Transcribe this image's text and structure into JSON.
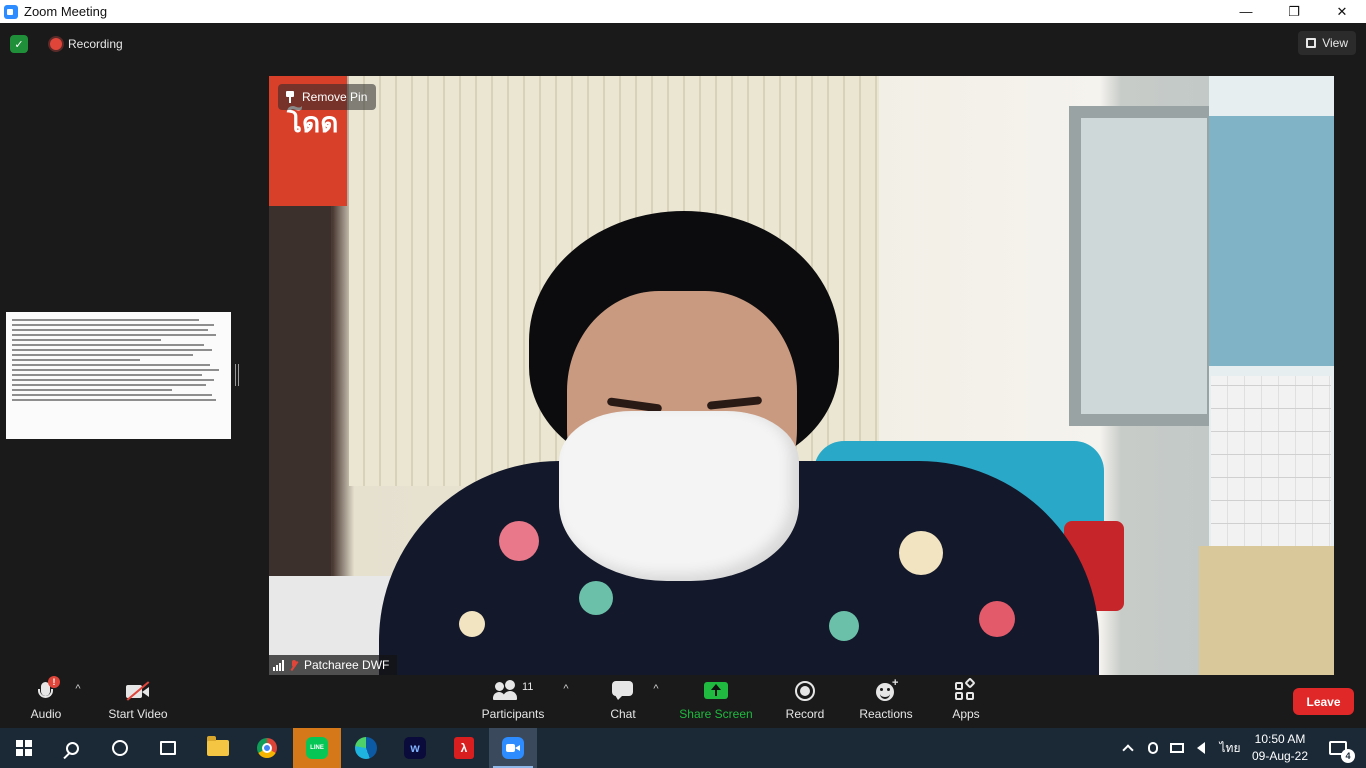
{
  "window": {
    "title": "Zoom Meeting",
    "controls": {
      "minimize": "—",
      "maximize": "❐",
      "close": "✕"
    }
  },
  "meeting": {
    "recording_label": "Recording",
    "view_label": "View",
    "remove_pin_label": "Remove Pin",
    "participant_name": "Patcharee DWF",
    "participant_muted": true,
    "signal_bars": 4
  },
  "toolbar": {
    "audio": {
      "label": "Audio",
      "alert": "!",
      "icon": "microphone-icon"
    },
    "video": {
      "label": "Start Video",
      "icon": "video-off-icon"
    },
    "participants": {
      "label": "Participants",
      "count": "11",
      "icon": "participants-icon"
    },
    "chat": {
      "label": "Chat",
      "icon": "chat-icon"
    },
    "share": {
      "label": "Share Screen",
      "icon": "share-screen-icon",
      "color": "#1fba3f"
    },
    "record": {
      "label": "Record",
      "icon": "record-icon"
    },
    "reactions": {
      "label": "Reactions",
      "icon": "reactions-icon"
    },
    "apps": {
      "label": "Apps",
      "icon": "apps-icon"
    },
    "leave": {
      "label": "Leave",
      "color": "#e02828"
    },
    "caret": "^"
  },
  "taskbar": {
    "apps": [
      {
        "name": "start",
        "icon": "windows-logo-icon"
      },
      {
        "name": "search",
        "icon": "search-icon"
      },
      {
        "name": "cortana",
        "icon": "cortana-icon"
      },
      {
        "name": "task-view",
        "icon": "task-view-icon"
      },
      {
        "name": "file-explorer",
        "icon": "folder-icon"
      },
      {
        "name": "chrome",
        "icon": "chrome-icon"
      },
      {
        "name": "line",
        "icon": "line-icon",
        "text": "LINE"
      },
      {
        "name": "edge",
        "icon": "edge-icon"
      },
      {
        "name": "webex",
        "icon": "webex-icon",
        "text": "w"
      },
      {
        "name": "acrobat",
        "icon": "pdf-icon",
        "text": "λ"
      },
      {
        "name": "zoom",
        "icon": "zoom-icon"
      }
    ],
    "language": "ไทย",
    "time": "10:50 AM",
    "date": "09-Aug-22",
    "notification_count": "4"
  }
}
